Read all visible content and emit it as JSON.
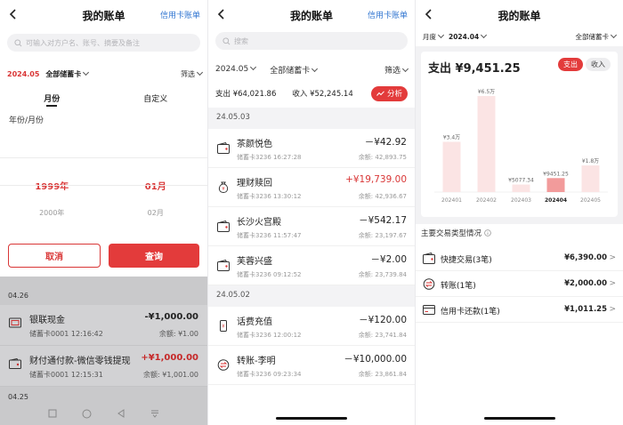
{
  "screen1": {
    "title": "我的账单",
    "right_link": "信用卡账单",
    "search_placeholder": "可输入对方户名、账号、摘要及备注",
    "date": "2024.05",
    "account": "全部储蓄卡",
    "filter": "筛选",
    "tabs": [
      "月份",
      "自定义"
    ],
    "label": "年份/月份",
    "picker_selected": [
      "1999年",
      "01月"
    ],
    "picker_next": [
      "2000年",
      "02月"
    ],
    "cancel": "取消",
    "query": "查询",
    "date_header_1": "04.26",
    "rows": [
      {
        "name": "银联现金",
        "sub": "储蓄卡0001 12:16:42",
        "amount": "-¥1,000.00",
        "balance": "余额: ¥1.00"
      },
      {
        "name": "财付通付款-微信零钱提现",
        "sub": "储蓄卡0001 12:15:31",
        "amount": "+¥1,000.00",
        "balance": "余额: ¥1,001.00"
      }
    ],
    "date_header_2": "04.25"
  },
  "screen2": {
    "title": "我的账单",
    "right_link": "信用卡账单",
    "search_placeholder": "搜索",
    "month": "2024.05",
    "account": "全部储蓄卡",
    "filter": "筛选",
    "expense": "支出 ¥64,021.86",
    "income": "收入 ¥52,245.14",
    "analyze": "分析",
    "day1": "24.05.03",
    "day1_tx": [
      {
        "name": "茶颜悦色",
        "sub": "储蓄卡3236  16:27:28",
        "amount": "－¥42.92",
        "balance": "余额: 42,893.75",
        "icon": "wallet-icon",
        "red": false
      },
      {
        "name": "理财赎回",
        "sub": "储蓄卡3236  13:30:12",
        "amount": "+¥19,739.00",
        "balance": "余额: 42,936.67",
        "icon": "money-bag-icon",
        "red": true
      },
      {
        "name": "长沙火宫殿",
        "sub": "储蓄卡3236  11:57:47",
        "amount": "－¥542.17",
        "balance": "余额: 23,197.67",
        "icon": "wallet-icon",
        "red": false
      },
      {
        "name": "芙蓉兴盛",
        "sub": "储蓄卡3236  09:12:52",
        "amount": "－¥2.00",
        "balance": "余额: 23,739.84",
        "icon": "wallet-icon",
        "red": false
      }
    ],
    "day2": "24.05.02",
    "day2_tx": [
      {
        "name": "话费充值",
        "sub": "储蓄卡3236  12:00:12",
        "amount": "－¥120.00",
        "balance": "余额: 23,741.84",
        "icon": "phone-icon",
        "red": false
      },
      {
        "name": "转账-李明",
        "sub": "储蓄卡3236  09:23:34",
        "amount": "－¥10,000.00",
        "balance": "余额: 23,861.84",
        "icon": "transfer-icon",
        "red": false
      }
    ]
  },
  "screen3": {
    "title": "我的账单",
    "period": "月度",
    "month": "2024.04",
    "account": "全部储蓄卡",
    "spend": "支出 ¥9,451.25",
    "toggle_on": "支出",
    "toggle_off": "收入",
    "section": "主要交易类型情况",
    "categories": [
      {
        "name": "快捷交易(3笔)",
        "amount": "¥6,390.00",
        "icon": "wallet-icon"
      },
      {
        "name": "转账(1笔)",
        "amount": "¥2,000.00",
        "icon": "transfer-icon"
      },
      {
        "name": "信用卡还款(1笔)",
        "amount": "¥1,011.25",
        "icon": "credit-card-icon"
      }
    ]
  },
  "chart_data": {
    "type": "bar",
    "categories": [
      "202401",
      "202402",
      "202403",
      "202404",
      "202405"
    ],
    "values": [
      34000,
      65000,
      5077.34,
      9451.25,
      18000
    ],
    "data_labels": [
      "¥3.4万",
      "¥6.5万",
      "¥5077.34",
      "¥9451.25",
      "¥1.8万"
    ],
    "highlight_index": 3,
    "colors": {
      "bar": "#fbe4e4",
      "highlight": "#f29b9b"
    }
  }
}
